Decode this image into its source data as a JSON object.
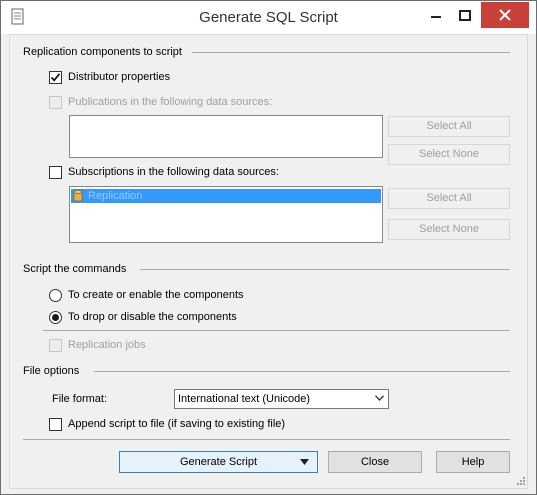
{
  "window": {
    "title": "Generate SQL Script",
    "icon": "document-icon",
    "controls": [
      "minimize-icon",
      "maximize-icon",
      "close-icon"
    ]
  },
  "replication": {
    "heading": "Replication components to script",
    "distributor_label": "Distributor properties",
    "distributor_checked": true,
    "publications_label": "Publications in the following data sources:",
    "publications_checked": false,
    "publications_enabled": false,
    "publications_items": [],
    "pub_select_all": "Select All",
    "pub_select_none": "Select None",
    "subscriptions_label": "Subscriptions in the following data sources:",
    "subscriptions_checked": false,
    "subscriptions_items": [
      {
        "label": "Replication",
        "icon": "database-icon",
        "selected": true
      }
    ],
    "sub_select_all": "Select All",
    "sub_select_none": "Select None"
  },
  "commands": {
    "heading": "Script the commands",
    "option_create": "To create or enable the components",
    "option_drop": "To drop or disable the components",
    "selected": "drop",
    "jobs_label": "Replication jobs",
    "jobs_enabled": false
  },
  "file_options": {
    "heading": "File options",
    "format_label": "File format:",
    "format_value": "International text (Unicode)",
    "append_label": "Append script to file (if saving to existing file)",
    "append_checked": false
  },
  "buttons": {
    "generate": "Generate Script",
    "close": "Close",
    "help": "Help"
  },
  "colors": {
    "selection": "#3399ff",
    "close_button": "#c7413a"
  }
}
